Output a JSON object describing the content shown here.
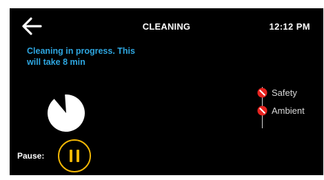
{
  "header": {
    "title": "CLEANING",
    "time": "12:12 PM"
  },
  "status": {
    "message": "Cleaning in progress. This will take 8 min",
    "progress": 0.1
  },
  "controls": {
    "pause_label": "Pause:"
  },
  "sensors": [
    {
      "label": "Safety",
      "state": "error",
      "icon": "no-entry-icon"
    },
    {
      "label": "Ambient",
      "state": "error",
      "icon": "no-entry-icon"
    }
  ],
  "colors": {
    "background": "#000000",
    "status_text": "#2ea6e0",
    "pause_accent": "#f2b705",
    "error": "#e8231f",
    "text": "#ffffff",
    "sensor_text": "#d8d8d8"
  }
}
